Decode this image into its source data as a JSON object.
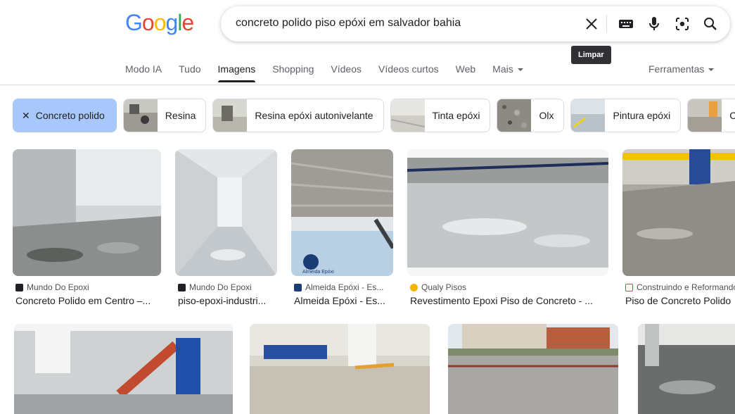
{
  "logo": {
    "letters": [
      "G",
      "o",
      "o",
      "g",
      "l",
      "e"
    ],
    "colors": [
      "#4285F4",
      "#EA4335",
      "#FBBC05",
      "#4285F4",
      "#34A853",
      "#EA4335"
    ]
  },
  "search": {
    "query": "concreto polido piso epóxi em salvador bahia",
    "clear_tooltip": "Limpar",
    "icons": [
      "close-icon",
      "keyboard-icon",
      "mic-icon",
      "lens-icon",
      "search-icon"
    ]
  },
  "nav": {
    "tabs": [
      "Modo IA",
      "Tudo",
      "Imagens",
      "Shopping",
      "Vídeos",
      "Vídeos curtos",
      "Web",
      "Mais"
    ],
    "active": "Imagens",
    "tools": "Ferramentas"
  },
  "chips": [
    {
      "label": "Concreto polido",
      "selected": true
    },
    {
      "label": "Resina"
    },
    {
      "label": "Resina epóxi autonivelante"
    },
    {
      "label": "Tinta epóxi"
    },
    {
      "label": "Olx"
    },
    {
      "label": "Pintura epóxi"
    },
    {
      "label": "Co"
    }
  ],
  "results": [
    {
      "source": "Mundo Do Epoxi",
      "title": "Concreto Polido em Centro –..."
    },
    {
      "source": "Mundo Do Epoxi",
      "title": "piso-epoxi-industri..."
    },
    {
      "source": "Almeida Epóxi - Es...",
      "title": "Almeida Epóxi - Es...",
      "watermark": "Almeida Epóxi"
    },
    {
      "source": "Qualy Pisos",
      "title": "Revestimento Epoxi Piso de Concreto - ..."
    },
    {
      "source": "Construindo e Reformando",
      "title": "Piso de Concreto Polido"
    }
  ],
  "colors": {
    "accent_chip": "#a8c7fa",
    "tab_underline": "#202124"
  }
}
